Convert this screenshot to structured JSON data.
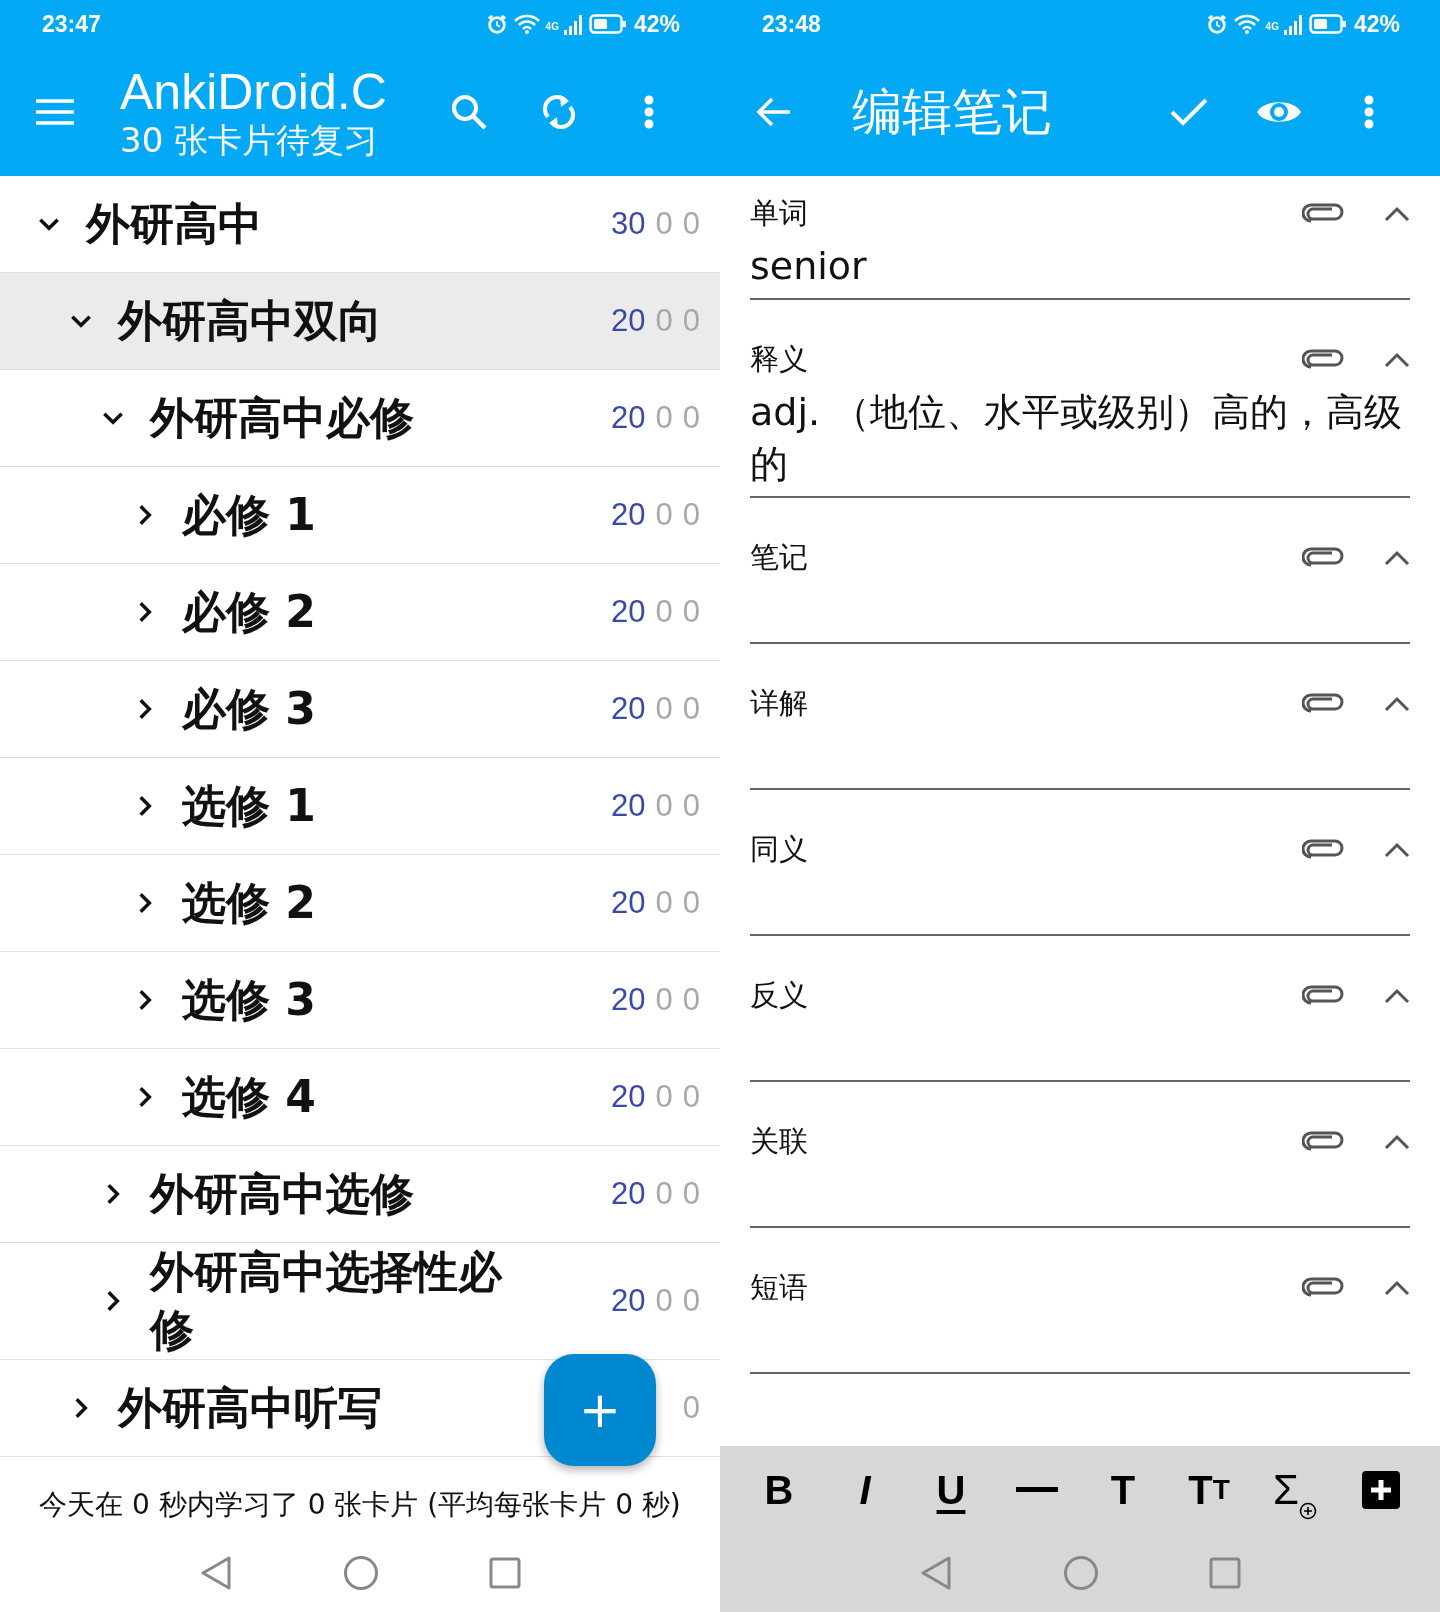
{
  "deck_screen": {
    "status_bar": {
      "time": "23:47",
      "network": "4G",
      "battery": "42%"
    },
    "app_bar": {
      "title": "AnkiDroid.C",
      "subtitle": "30 张卡片待复习"
    },
    "decks": [
      {
        "name": "外研高中",
        "expanded": true,
        "selected": false,
        "due": "30",
        "new": "0",
        "learn": "0",
        "children": [
          {
            "name": "外研高中双向",
            "expanded": true,
            "selected": true,
            "due": "20",
            "new": "0",
            "learn": "0",
            "children": [
              {
                "name": "外研高中必修",
                "expanded": true,
                "selected": false,
                "due": "20",
                "new": "0",
                "learn": "0",
                "children": [
                  {
                    "name": "必修 1",
                    "expanded": false,
                    "selected": false,
                    "due": "20",
                    "new": "0",
                    "learn": "0"
                  },
                  {
                    "name": "必修 2",
                    "expanded": false,
                    "selected": false,
                    "due": "20",
                    "new": "0",
                    "learn": "0"
                  },
                  {
                    "name": "必修 3",
                    "expanded": false,
                    "selected": false,
                    "due": "20",
                    "new": "0",
                    "learn": "0"
                  },
                  {
                    "name": "选修 1",
                    "expanded": false,
                    "selected": false,
                    "due": "20",
                    "new": "0",
                    "learn": "0"
                  },
                  {
                    "name": "选修 2",
                    "expanded": false,
                    "selected": false,
                    "due": "20",
                    "new": "0",
                    "learn": "0"
                  },
                  {
                    "name": "选修 3",
                    "expanded": false,
                    "selected": false,
                    "due": "20",
                    "new": "0",
                    "learn": "0"
                  },
                  {
                    "name": "选修 4",
                    "expanded": false,
                    "selected": false,
                    "due": "20",
                    "new": "0",
                    "learn": "0"
                  }
                ]
              },
              {
                "name": "外研高中选修",
                "expanded": false,
                "selected": false,
                "due": "20",
                "new": "0",
                "learn": "0"
              },
              {
                "name": "外研高中选择性必修",
                "expanded": false,
                "selected": false,
                "due": "20",
                "new": "0",
                "learn": "0"
              }
            ]
          },
          {
            "name": "外研高中听写",
            "expanded": false,
            "selected": false,
            "learn": "0"
          }
        ]
      }
    ],
    "fab": {
      "label": "+"
    },
    "footer": "今天在 0 秒内学习了 0 张卡片 (平均每张卡片 0 秒)"
  },
  "editor_screen": {
    "status_bar": {
      "time": "23:48",
      "network": "4G",
      "battery": "42%"
    },
    "app_bar": {
      "title": "编辑笔记"
    },
    "fields": [
      {
        "label": "单词",
        "value": "senior"
      },
      {
        "label": "释义",
        "value": "adj. （地位、水平或级别）高的，高级的"
      },
      {
        "label": "笔记"
      },
      {
        "label": "详解"
      },
      {
        "label": "同义"
      },
      {
        "label": "反义"
      },
      {
        "label": "关联"
      },
      {
        "label": "短语"
      }
    ],
    "toolbar": [
      {
        "kind": "bold",
        "label": "B"
      },
      {
        "kind": "italic",
        "label": "I"
      },
      {
        "kind": "underline",
        "label": "U"
      },
      {
        "kind": "rule"
      },
      {
        "kind": "heading",
        "label": "T"
      },
      {
        "kind": "font-size",
        "labels": [
          "T",
          "T"
        ]
      },
      {
        "kind": "math",
        "label": "Σ"
      },
      {
        "kind": "add"
      }
    ]
  }
}
